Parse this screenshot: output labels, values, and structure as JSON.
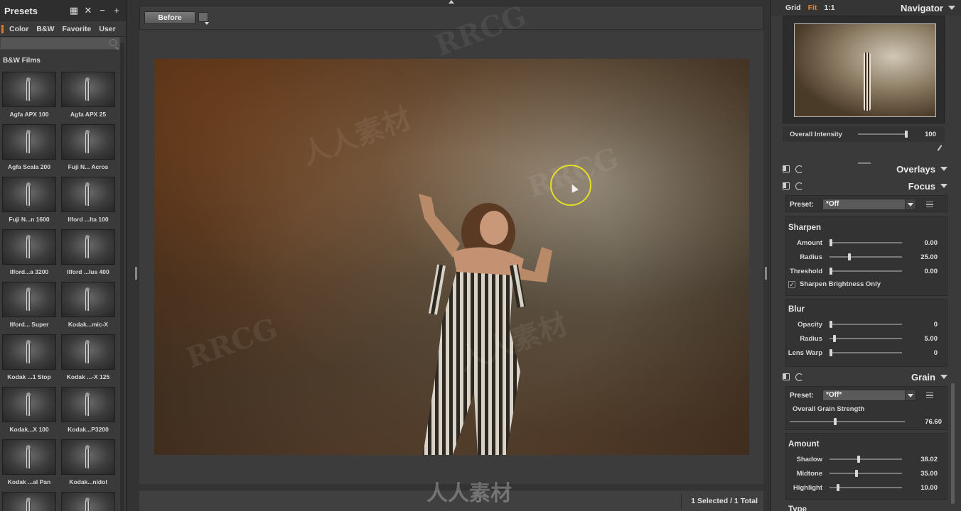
{
  "presets": {
    "title": "Presets",
    "tabs": [
      "Color",
      "B&W",
      "Favorite",
      "User"
    ],
    "group": "B&W Films",
    "items": [
      "Agfa APX 100",
      "Agfa APX 25",
      "Agfa Scala 200",
      "Fuji N... Acros",
      "Fuji N...n 1600",
      "Ilford ...lta 100",
      "Ilford...a 3200",
      "Ilford ...lus 400",
      "Ilford... Super",
      "Kodak...mic-X",
      "Kodak ...1 Stop",
      "Kodak ...-X 125",
      "Kodak...X 100",
      "Kodak...P3200",
      "Kodak ...al Pan",
      "Kodak...nidol"
    ]
  },
  "viewer": {
    "before_label": "Before",
    "status": "1 Selected / 1 Total"
  },
  "navigator": {
    "options": [
      "Grid",
      "Fit",
      "1:1"
    ],
    "active_option": "Fit",
    "title": "Navigator",
    "intensity_label": "Overall Intensity",
    "intensity_value": "100",
    "intensity_fraction": 1.0
  },
  "overlays": {
    "title": "Overlays"
  },
  "focus": {
    "title": "Focus",
    "preset_label": "Preset:",
    "preset_value": "*Off",
    "sharpen": {
      "title": "Sharpen",
      "rows": [
        {
          "label": "Amount",
          "value": "0.00",
          "fraction": 0.0
        },
        {
          "label": "Radius",
          "value": "25.00",
          "fraction": 0.25
        },
        {
          "label": "Threshold",
          "value": "0.00",
          "fraction": 0.0
        }
      ],
      "checkbox_label": "Sharpen Brightness Only",
      "checked": true
    },
    "blur": {
      "title": "Blur",
      "rows": [
        {
          "label": "Opacity",
          "value": "0",
          "fraction": 0.0
        },
        {
          "label": "Radius",
          "value": "5.00",
          "fraction": 0.05
        },
        {
          "label": "Lens Warp",
          "value": "0",
          "fraction": 0.0
        }
      ]
    }
  },
  "grain": {
    "title": "Grain",
    "preset_label": "Preset:",
    "preset_value": "*Off*",
    "strength_label": "Overall Grain Strength",
    "strength_value": "76.60",
    "strength_fraction": 0.38,
    "amount": {
      "title": "Amount",
      "rows": [
        {
          "label": "Shadow",
          "value": "38.02",
          "fraction": 0.38
        },
        {
          "label": "Midtone",
          "value": "35.00",
          "fraction": 0.35
        },
        {
          "label": "Highlight",
          "value": "10.00",
          "fraction": 0.1
        }
      ]
    },
    "next_title": "Type"
  },
  "watermark": {
    "text_latin": "RRCG",
    "text_cn": "人人素材"
  }
}
